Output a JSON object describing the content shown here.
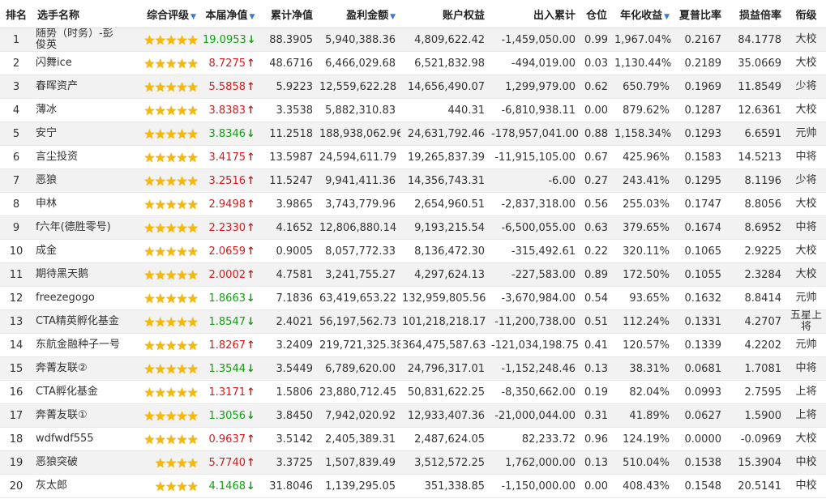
{
  "headers": {
    "rank": "排名",
    "name": "选手名称",
    "rating": "综合评级",
    "nav": "本届净值",
    "cum_nav": "累计净值",
    "profit": "盈利金额",
    "equity": "账户权益",
    "flow": "出入累计",
    "position": "仓位",
    "annual": "年化收益",
    "sharpe": "夏普比率",
    "plr": "损益倍率",
    "title": "衔级",
    "sort_icon": "▼"
  },
  "colors": {
    "up": "#d01d1d",
    "down": "#12a012",
    "star": "#f7b900",
    "sort": "#3a7bd5"
  },
  "rows": [
    {
      "rank": "1",
      "name": "随势（时务）-彭俊英",
      "stars": 5,
      "nav": "19.0953",
      "dir": "down",
      "cum": "88.3905",
      "profit": "5,940,388.36",
      "equity": "4,809,622.42",
      "flow": "-1,459,050.00",
      "pos": "0.99",
      "ann": "1,967.04%",
      "sharpe": "0.2167",
      "plr": "84.1778",
      "title": "大校"
    },
    {
      "rank": "2",
      "name": "闪舞ice",
      "stars": 5,
      "nav": "8.7275",
      "dir": "up",
      "cum": "48.6716",
      "profit": "6,466,029.68",
      "equity": "6,521,832.98",
      "flow": "-494,019.00",
      "pos": "0.03",
      "ann": "1,130.44%",
      "sharpe": "0.2189",
      "plr": "35.0669",
      "title": "大校"
    },
    {
      "rank": "3",
      "name": "春晖资产",
      "stars": 5,
      "nav": "5.5858",
      "dir": "up",
      "cum": "5.9223",
      "profit": "12,559,622.28",
      "equity": "14,656,490.07",
      "flow": "1,299,979.00",
      "pos": "0.62",
      "ann": "650.79%",
      "sharpe": "0.1969",
      "plr": "11.8549",
      "title": "少将"
    },
    {
      "rank": "4",
      "name": "薄冰",
      "stars": 5,
      "nav": "3.8383",
      "dir": "up",
      "cum": "3.3538",
      "profit": "5,882,310.83",
      "equity": "440.31",
      "flow": "-6,810,938.11",
      "pos": "0.00",
      "ann": "879.62%",
      "sharpe": "0.1287",
      "plr": "12.6361",
      "title": "大校"
    },
    {
      "rank": "5",
      "name": "安宁",
      "stars": 5,
      "nav": "3.8346",
      "dir": "down",
      "cum": "11.2518",
      "profit": "188,938,062.96",
      "equity": "24,631,792.46",
      "flow": "-178,957,041.00",
      "pos": "0.88",
      "ann": "1,158.34%",
      "sharpe": "0.1293",
      "plr": "6.6591",
      "title": "元帅"
    },
    {
      "rank": "6",
      "name": "言尘投资",
      "stars": 5,
      "nav": "3.4175",
      "dir": "up",
      "cum": "13.5987",
      "profit": "24,594,611.79",
      "equity": "19,265,837.39",
      "flow": "-11,915,105.00",
      "pos": "0.67",
      "ann": "425.96%",
      "sharpe": "0.1583",
      "plr": "14.5213",
      "title": "中将"
    },
    {
      "rank": "7",
      "name": "恶狼",
      "stars": 5,
      "nav": "3.2516",
      "dir": "up",
      "cum": "11.5247",
      "profit": "9,941,411.36",
      "equity": "14,356,743.31",
      "flow": "-6.00",
      "pos": "0.27",
      "ann": "243.41%",
      "sharpe": "0.1295",
      "plr": "8.1196",
      "title": "少将"
    },
    {
      "rank": "8",
      "name": "申林",
      "stars": 5,
      "nav": "2.9498",
      "dir": "up",
      "cum": "3.9865",
      "profit": "3,743,779.96",
      "equity": "2,654,960.51",
      "flow": "-2,837,318.00",
      "pos": "0.56",
      "ann": "255.03%",
      "sharpe": "0.1747",
      "plr": "8.8056",
      "title": "大校"
    },
    {
      "rank": "9",
      "name": "f六年(德胜零号)",
      "stars": 5,
      "nav": "2.2330",
      "dir": "up",
      "cum": "4.1652",
      "profit": "12,806,880.14",
      "equity": "9,193,215.54",
      "flow": "-6,500,055.00",
      "pos": "0.63",
      "ann": "379.65%",
      "sharpe": "0.1674",
      "plr": "8.6952",
      "title": "中将"
    },
    {
      "rank": "10",
      "name": "成金",
      "stars": 5,
      "nav": "2.0659",
      "dir": "up",
      "cum": "0.9005",
      "profit": "8,057,772.33",
      "equity": "8,136,472.30",
      "flow": "-315,492.61",
      "pos": "0.22",
      "ann": "320.11%",
      "sharpe": "0.1065",
      "plr": "2.9225",
      "title": "大校"
    },
    {
      "rank": "11",
      "name": "期待黑天鹅",
      "stars": 5,
      "nav": "2.0002",
      "dir": "up",
      "cum": "4.7581",
      "profit": "3,241,755.27",
      "equity": "4,297,624.13",
      "flow": "-227,583.00",
      "pos": "0.89",
      "ann": "172.50%",
      "sharpe": "0.1055",
      "plr": "2.3284",
      "title": "大校"
    },
    {
      "rank": "12",
      "name": "freezegogo",
      "stars": 5,
      "nav": "1.8663",
      "dir": "down",
      "cum": "7.1836",
      "profit": "63,419,653.22",
      "equity": "132,959,805.56",
      "flow": "-3,670,984.00",
      "pos": "0.54",
      "ann": "93.65%",
      "sharpe": "0.1632",
      "plr": "8.8414",
      "title": "元帅"
    },
    {
      "rank": "13",
      "name": "CTA精英孵化基金",
      "stars": 5,
      "nav": "1.8547",
      "dir": "down",
      "cum": "2.4021",
      "profit": "56,197,562.73",
      "equity": "101,218,218.17",
      "flow": "-11,200,738.00",
      "pos": "0.51",
      "ann": "112.24%",
      "sharpe": "0.1331",
      "plr": "4.2707",
      "title": "五星上将"
    },
    {
      "rank": "14",
      "name": "东航金融种子一号",
      "stars": 5,
      "nav": "1.8267",
      "dir": "up",
      "cum": "3.2409",
      "profit": "219,721,325.38",
      "equity": "364,475,587.63",
      "flow": "-121,034,198.75",
      "pos": "0.41",
      "ann": "120.57%",
      "sharpe": "0.1339",
      "plr": "4.2202",
      "title": "元帅"
    },
    {
      "rank": "15",
      "name": "奔菁友联②",
      "stars": 5,
      "nav": "1.3544",
      "dir": "down",
      "cum": "3.5449",
      "profit": "6,789,620.00",
      "equity": "24,796,317.01",
      "flow": "-1,152,248.46",
      "pos": "0.13",
      "ann": "38.31%",
      "sharpe": "0.0681",
      "plr": "1.7081",
      "title": "中将"
    },
    {
      "rank": "16",
      "name": "CTA孵化基金",
      "stars": 5,
      "nav": "1.3171",
      "dir": "up",
      "cum": "1.5806",
      "profit": "23,880,712.45",
      "equity": "50,831,622.25",
      "flow": "-8,350,662.00",
      "pos": "0.19",
      "ann": "82.04%",
      "sharpe": "0.0993",
      "plr": "2.7595",
      "title": "上将"
    },
    {
      "rank": "17",
      "name": "奔菁友联①",
      "stars": 5,
      "nav": "1.3056",
      "dir": "down",
      "cum": "3.8450",
      "profit": "7,942,020.92",
      "equity": "12,933,407.36",
      "flow": "-21,000,044.00",
      "pos": "0.31",
      "ann": "41.89%",
      "sharpe": "0.0627",
      "plr": "1.5900",
      "title": "上将"
    },
    {
      "rank": "18",
      "name": "wdfwdf555",
      "stars": 5,
      "nav": "0.9637",
      "dir": "up",
      "cum": "3.5142",
      "profit": "2,405,389.31",
      "equity": "2,487,624.05",
      "flow": "82,233.72",
      "pos": "0.96",
      "ann": "124.19%",
      "sharpe": "0.0000",
      "plr": "-0.0969",
      "title": "大校"
    },
    {
      "rank": "19",
      "name": "恶狼突破",
      "stars": 4,
      "nav": "5.7740",
      "dir": "up",
      "cum": "3.3725",
      "profit": "1,507,839.49",
      "equity": "3,512,572.25",
      "flow": "1,762,000.00",
      "pos": "0.13",
      "ann": "510.04%",
      "sharpe": "0.1538",
      "plr": "15.3904",
      "title": "中校"
    },
    {
      "rank": "20",
      "name": "灰太郎",
      "stars": 4,
      "nav": "4.1468",
      "dir": "down",
      "cum": "31.8046",
      "profit": "1,139,295.05",
      "equity": "351,338.85",
      "flow": "-1,150,000.00",
      "pos": "0.00",
      "ann": "408.43%",
      "sharpe": "0.1548",
      "plr": "20.5141",
      "title": "中校"
    }
  ]
}
